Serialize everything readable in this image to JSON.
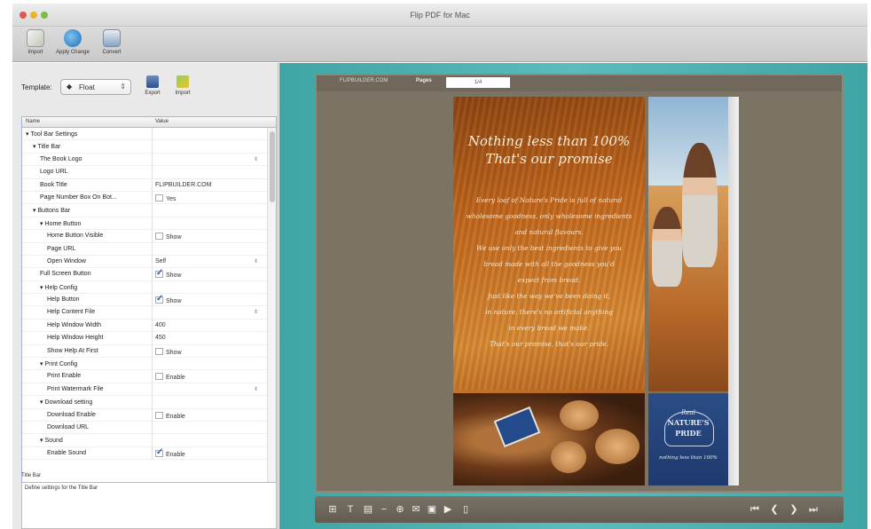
{
  "window": {
    "title": "Flip PDF for Mac"
  },
  "toolbar": {
    "buttons": [
      {
        "label": "Import"
      },
      {
        "label": "Apply Change"
      },
      {
        "label": "Convert"
      }
    ]
  },
  "left": {
    "template_label": "Template:",
    "template_value": "Float",
    "export_label": "Export",
    "import_label": "Import",
    "columns": {
      "name": "Name",
      "value": "Value"
    },
    "rows": [
      {
        "name": "Tool Bar Settings",
        "level": 0,
        "caret": "▾",
        "value": "",
        "kind": "none"
      },
      {
        "name": "Title Bar",
        "level": 1,
        "caret": "▾",
        "value": "",
        "kind": "none"
      },
      {
        "name": "The Book Logo",
        "level": 2,
        "caret": "",
        "value": "",
        "kind": "select"
      },
      {
        "name": "Logo URL",
        "level": 2,
        "caret": "",
        "value": "",
        "kind": "none"
      },
      {
        "name": "Book Title",
        "level": 2,
        "caret": "",
        "value": "FLIPBUILDER.COM",
        "kind": "text"
      },
      {
        "name": "Page Number Box On Bot...",
        "level": 2,
        "caret": "",
        "value": "Yes",
        "kind": "check-off"
      },
      {
        "name": "Buttons Bar",
        "level": 1,
        "caret": "▾",
        "value": "",
        "kind": "none"
      },
      {
        "name": "Home Button",
        "level": 2,
        "caret": "▾",
        "value": "",
        "kind": "none"
      },
      {
        "name": "Home Button Visible",
        "level": 3,
        "caret": "",
        "value": "Show",
        "kind": "check-off"
      },
      {
        "name": "Page URL",
        "level": 3,
        "caret": "",
        "value": "",
        "kind": "none"
      },
      {
        "name": "Open Window",
        "level": 3,
        "caret": "",
        "value": "Self",
        "kind": "select"
      },
      {
        "name": "Full Screen Button",
        "level": 2,
        "caret": "",
        "value": "Show",
        "kind": "check-on"
      },
      {
        "name": "Help Config",
        "level": 2,
        "caret": "▾",
        "value": "",
        "kind": "none"
      },
      {
        "name": "Help Button",
        "level": 3,
        "caret": "",
        "value": "Show",
        "kind": "check-on"
      },
      {
        "name": "Help Content File",
        "level": 3,
        "caret": "",
        "value": "",
        "kind": "select"
      },
      {
        "name": "Help Window Width",
        "level": 3,
        "caret": "",
        "value": "400",
        "kind": "text"
      },
      {
        "name": "Help Window Height",
        "level": 3,
        "caret": "",
        "value": "450",
        "kind": "text"
      },
      {
        "name": "Show Help At First",
        "level": 3,
        "caret": "",
        "value": "Show",
        "kind": "check-off"
      },
      {
        "name": "Print Config",
        "level": 2,
        "caret": "▾",
        "value": "",
        "kind": "none"
      },
      {
        "name": "Print Enable",
        "level": 3,
        "caret": "",
        "value": "Enable",
        "kind": "check-off"
      },
      {
        "name": "Print Watermark File",
        "level": 3,
        "caret": "",
        "value": "",
        "kind": "select"
      },
      {
        "name": "Download setting",
        "level": 2,
        "caret": "▾",
        "value": "",
        "kind": "none"
      },
      {
        "name": "Download Enable",
        "level": 3,
        "caret": "",
        "value": "Enable",
        "kind": "check-off"
      },
      {
        "name": "Download URL",
        "level": 3,
        "caret": "",
        "value": "",
        "kind": "none"
      },
      {
        "name": "Sound",
        "level": 2,
        "caret": "▾",
        "value": "",
        "kind": "none"
      },
      {
        "name": "Enable Sound",
        "level": 3,
        "caret": "",
        "value": "Enable",
        "kind": "check-on"
      }
    ],
    "desc_head": "Title Bar",
    "desc_text": "Define settings for the Title Bar"
  },
  "preview": {
    "brand": "FLIPBUILDER.COM",
    "pages_label": "Pages",
    "page_value": "1/4",
    "book": {
      "headline_lines": [
        "Nothing less than 100%",
        "That's our promise"
      ],
      "body_lines": [
        "Every loaf of Nature's Pride is full of natural",
        "wholesome goodness, only wholesome ingredients",
        "and natural flavours.",
        "We use only the best ingredients to give you",
        "bread made with all the goodness you'd",
        "expect from bread.",
        "Just like the way we've been doing it,",
        "in nature, there's no artificial anything",
        "in every bread we make.",
        "That's our promise, that's our pride."
      ],
      "logo_top": "Real",
      "logo_name": "NATURE'S",
      "logo_sub": "PRIDE",
      "logo_tag": "nothing less than 100%"
    },
    "colors": {
      "accent": "#3fa5a4",
      "frame": "#7b7364"
    }
  }
}
